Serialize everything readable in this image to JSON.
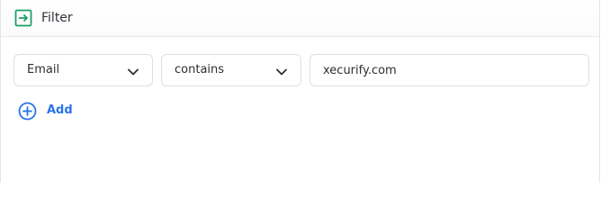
{
  "header": {
    "icon": "filter-enter-icon",
    "title": "Filter",
    "accent_color": "#1e9e6a"
  },
  "filter": {
    "field": {
      "selected": "Email",
      "icon": "chevron-down-icon"
    },
    "operator": {
      "selected": "contains",
      "icon": "chevron-down-icon"
    },
    "value": {
      "text": "xecurify.com"
    }
  },
  "actions": {
    "add_label": "Add",
    "add_icon": "plus-circle-icon",
    "accent_color": "#2874e8"
  }
}
